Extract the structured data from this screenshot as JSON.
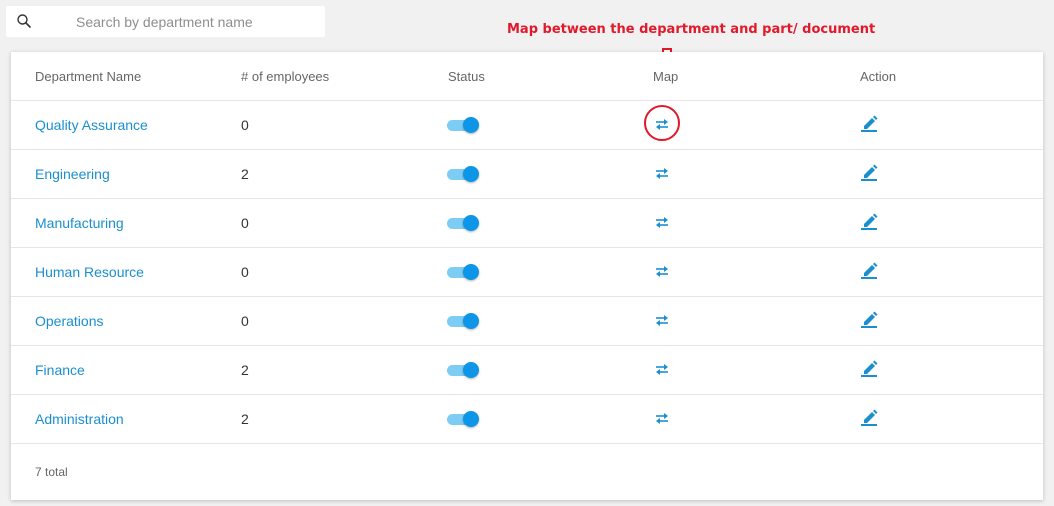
{
  "search": {
    "placeholder": "Search by department name",
    "value": ""
  },
  "annotation": {
    "text": "Map between the department and part/ document",
    "color": "#e0192b"
  },
  "table": {
    "headers": {
      "name": "Department Name",
      "employees": "# of employees",
      "status": "Status",
      "map": "Map",
      "action": "Action"
    },
    "rows": [
      {
        "name": "Quality Assurance",
        "employees": "0",
        "status": "on"
      },
      {
        "name": "Engineering",
        "employees": "2",
        "status": "on"
      },
      {
        "name": "Manufacturing",
        "employees": "0",
        "status": "on"
      },
      {
        "name": "Human Resource",
        "employees": "0",
        "status": "on"
      },
      {
        "name": "Operations",
        "employees": "0",
        "status": "on"
      },
      {
        "name": "Finance",
        "employees": "2",
        "status": "on"
      },
      {
        "name": "Administration",
        "employees": "2",
        "status": "on"
      }
    ],
    "footer": "7 total"
  },
  "icons": {
    "search": "search-icon",
    "map": "swap-arrows-icon",
    "edit": "pencil-edit-icon",
    "annotation_arrow": "arrow-down-icon"
  },
  "colors": {
    "link": "#1a8fd0",
    "toggle_track": "#7cccf4",
    "toggle_knob": "#0d95e8",
    "annotation": "#e0192b"
  }
}
